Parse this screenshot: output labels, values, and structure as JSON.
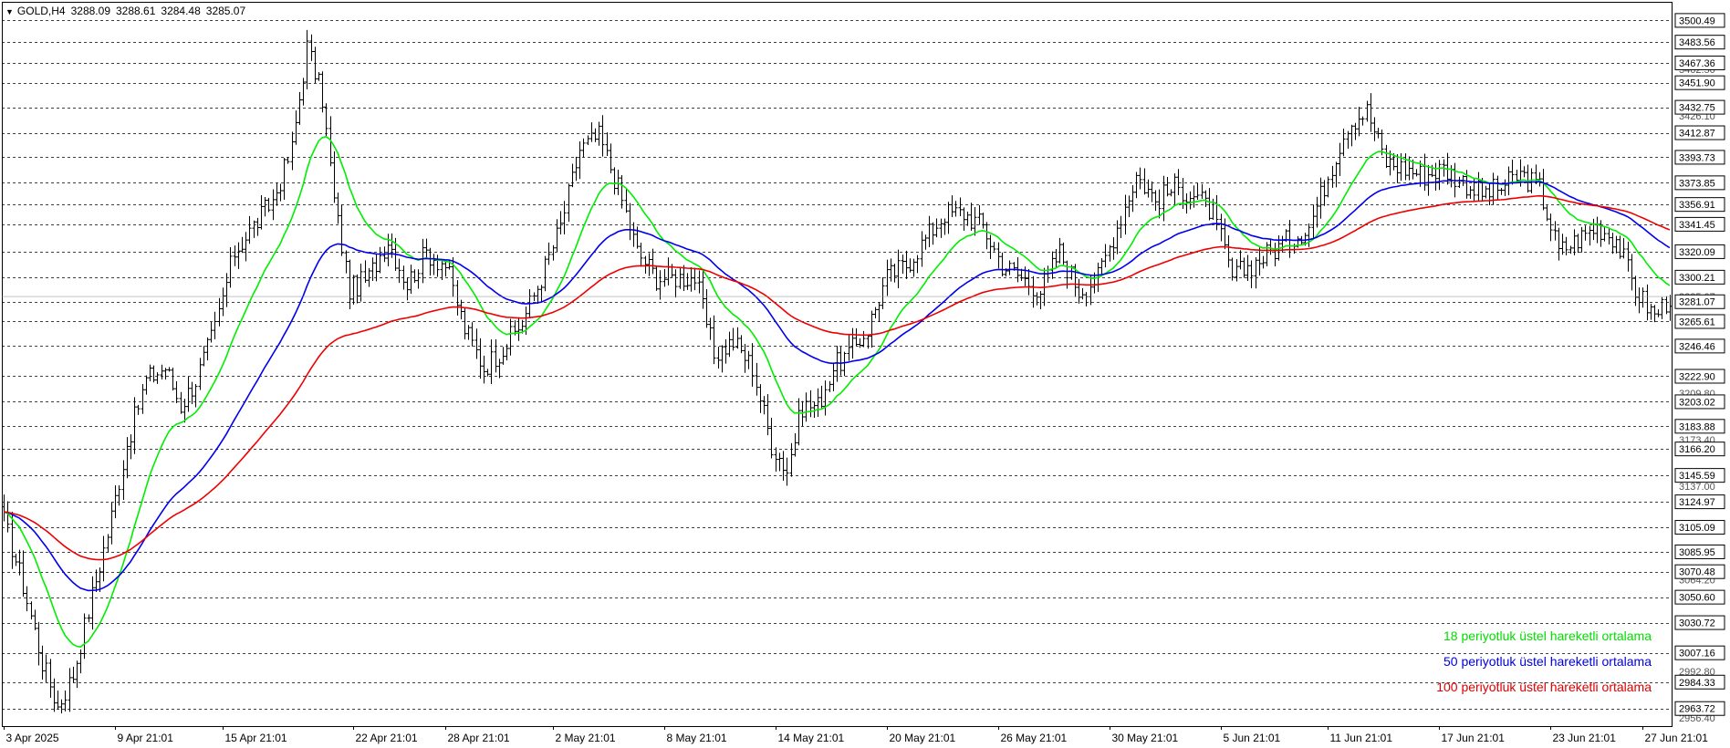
{
  "header": {
    "symbol": "GOLD,H4",
    "open": "3288.09",
    "high": "3288.61",
    "low": "3284.48",
    "close": "3285.07"
  },
  "chart_data": {
    "type": "candlestick",
    "symbol": "GOLD",
    "timeframe": "H4",
    "ylim": [
      2950,
      3515
    ],
    "y_ticks_boxed": [
      3500.49,
      3483.56,
      3467.36,
      3451.9,
      3432.75,
      3412.87,
      3393.73,
      3373.85,
      3356.91,
      3341.45,
      3320.09,
      3300.21,
      3281.07,
      3265.61,
      3246.46,
      3222.9,
      3203.02,
      3183.88,
      3166.2,
      3145.59,
      3124.97,
      3105.09,
      3085.95,
      3070.48,
      3050.6,
      3030.72,
      3007.16,
      2984.33,
      2963.72
    ],
    "y_ticks_plain": [
      3462.5,
      3426.1,
      3285.07,
      3209.8,
      3173.4,
      3137.0,
      3064.2,
      2992.8,
      2956.4
    ],
    "x_ticks": [
      "3 Apr 2025",
      "9 Apr 21:01",
      "15 Apr 21:01",
      "22 Apr 21:01",
      "28 Apr 21:01",
      "2 May 21:01",
      "8 May 21:01",
      "14 May 21:01",
      "20 May 21:01",
      "26 May 21:01",
      "30 May 21:01",
      "5 Jun 21:01",
      "11 Jun 21:01",
      "17 Jun 21:01",
      "23 Jun 21:01",
      "27 Jun 21:01"
    ],
    "x_tick_bars": [
      0,
      29,
      57,
      91,
      115,
      143,
      172,
      201,
      230,
      259,
      288,
      317,
      345,
      374,
      403,
      427
    ],
    "n_bars": 435,
    "price_anchors": [
      [
        0,
        3110
      ],
      [
        5,
        3060
      ],
      [
        10,
        3000
      ],
      [
        14,
        2965
      ],
      [
        18,
        2990
      ],
      [
        22,
        3040
      ],
      [
        27,
        3100
      ],
      [
        32,
        3170
      ],
      [
        37,
        3220
      ],
      [
        42,
        3230
      ],
      [
        46,
        3200
      ],
      [
        50,
        3220
      ],
      [
        55,
        3260
      ],
      [
        60,
        3320
      ],
      [
        65,
        3340
      ],
      [
        70,
        3360
      ],
      [
        75,
        3400
      ],
      [
        79,
        3480
      ],
      [
        83,
        3440
      ],
      [
        86,
        3360
      ],
      [
        90,
        3290
      ],
      [
        95,
        3300
      ],
      [
        100,
        3330
      ],
      [
        105,
        3295
      ],
      [
        110,
        3320
      ],
      [
        115,
        3310
      ],
      [
        120,
        3260
      ],
      [
        125,
        3230
      ],
      [
        130,
        3245
      ],
      [
        135,
        3265
      ],
      [
        140,
        3300
      ],
      [
        145,
        3340
      ],
      [
        150,
        3400
      ],
      [
        155,
        3410
      ],
      [
        160,
        3370
      ],
      [
        165,
        3320
      ],
      [
        170,
        3300
      ],
      [
        175,
        3300
      ],
      [
        180,
        3300
      ],
      [
        185,
        3240
      ],
      [
        190,
        3250
      ],
      [
        195,
        3230
      ],
      [
        200,
        3170
      ],
      [
        204,
        3150
      ],
      [
        208,
        3200
      ],
      [
        212,
        3200
      ],
      [
        216,
        3230
      ],
      [
        220,
        3240
      ],
      [
        225,
        3260
      ],
      [
        230,
        3300
      ],
      [
        235,
        3310
      ],
      [
        240,
        3330
      ],
      [
        245,
        3350
      ],
      [
        250,
        3350
      ],
      [
        255,
        3340
      ],
      [
        260,
        3310
      ],
      [
        265,
        3300
      ],
      [
        270,
        3290
      ],
      [
        275,
        3320
      ],
      [
        280,
        3290
      ],
      [
        285,
        3300
      ],
      [
        290,
        3340
      ],
      [
        295,
        3380
      ],
      [
        300,
        3360
      ],
      [
        305,
        3370
      ],
      [
        310,
        3365
      ],
      [
        315,
        3350
      ],
      [
        320,
        3300
      ],
      [
        325,
        3310
      ],
      [
        330,
        3320
      ],
      [
        335,
        3330
      ],
      [
        340,
        3340
      ],
      [
        345,
        3380
      ],
      [
        350,
        3420
      ],
      [
        355,
        3430
      ],
      [
        360,
        3390
      ],
      [
        365,
        3385
      ],
      [
        370,
        3380
      ],
      [
        375,
        3385
      ],
      [
        380,
        3375
      ],
      [
        385,
        3365
      ],
      [
        390,
        3370
      ],
      [
        395,
        3380
      ],
      [
        400,
        3370
      ],
      [
        405,
        3320
      ],
      [
        410,
        3330
      ],
      [
        415,
        3340
      ],
      [
        420,
        3330
      ],
      [
        425,
        3290
      ],
      [
        430,
        3270
      ],
      [
        434,
        3285
      ]
    ],
    "ema_periods": [
      18,
      50,
      100
    ],
    "ema_colors": [
      "#00ee00",
      "#0000ee",
      "#ee0000"
    ],
    "current_price": 3285.07,
    "legend": [
      {
        "label": "18 periyotluk üstel hareketli ortalama",
        "color": "#00dd00"
      },
      {
        "label": "50 periyotluk üstel hareketli ortalama",
        "color": "#0000dd"
      },
      {
        "label": "100 periyotluk üstel hareketli ortalama",
        "color": "#dd0000"
      }
    ],
    "grid": true
  }
}
